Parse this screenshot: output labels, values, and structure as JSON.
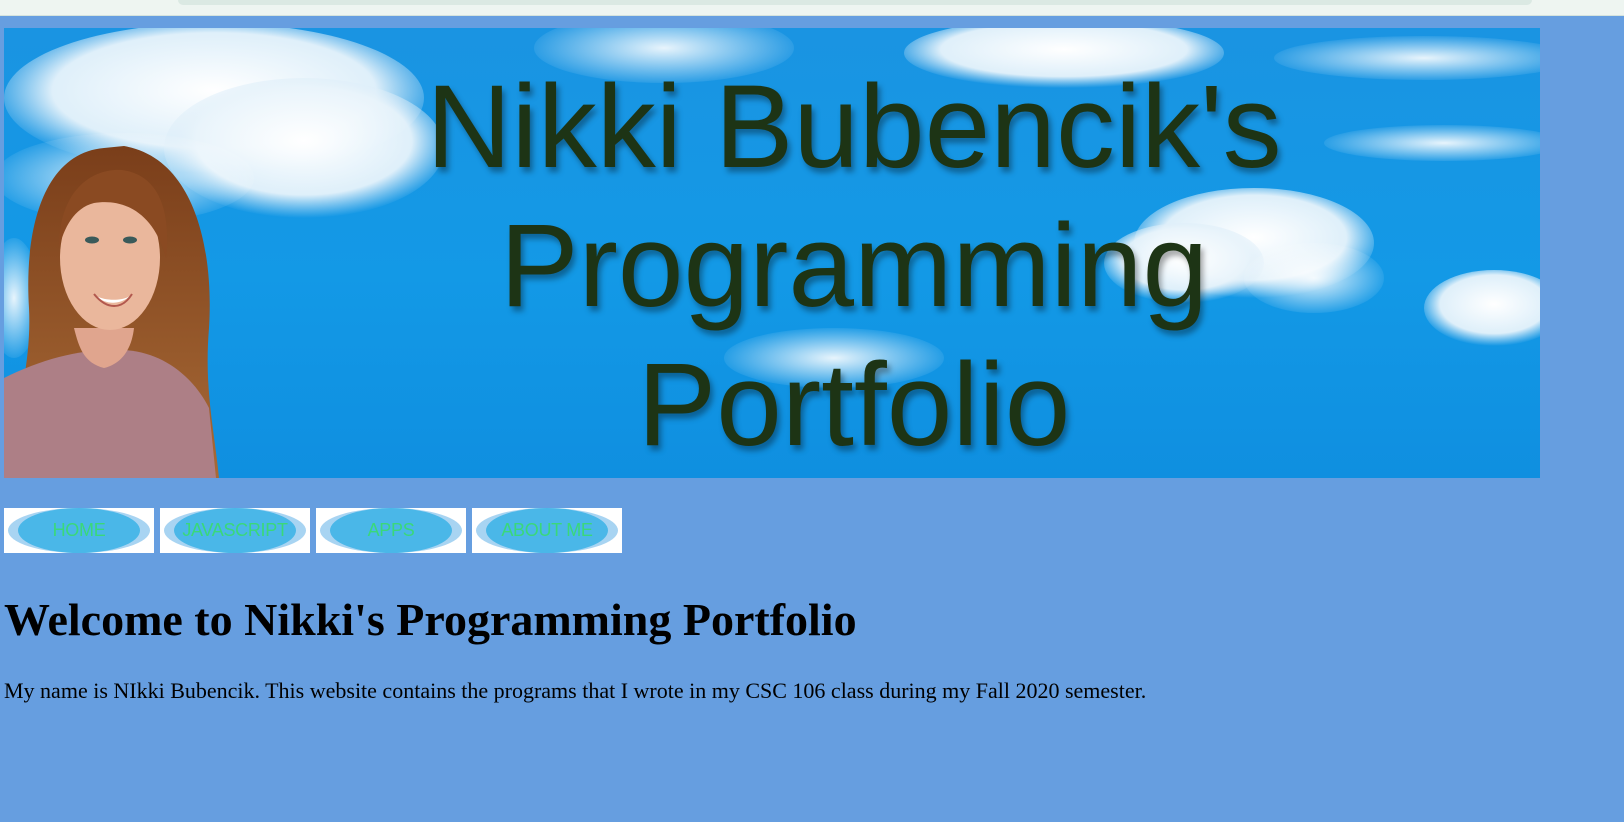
{
  "banner": {
    "title_lines": [
      "Nikki Bubencik's",
      "Programming",
      "Portfolio"
    ],
    "portrait_alt": "Portrait of Nikki",
    "sky_color": "#1399e6",
    "title_color": "#1d3415"
  },
  "nav": {
    "items": [
      {
        "label": "HOME"
      },
      {
        "label": "JAVASCRIPT"
      },
      {
        "label": "APPS"
      },
      {
        "label": "ABOUT ME"
      }
    ],
    "label_color": "#3ad87a",
    "button_color": "#4ab7e8"
  },
  "main": {
    "heading": "Welcome to Nikki's Programming Portfolio",
    "intro": "My name is NIkki Bubencik. This website contains the programs that I wrote in my CSC 106 class during my Fall 2020 semester."
  },
  "page": {
    "background_color": "#669ee0"
  }
}
